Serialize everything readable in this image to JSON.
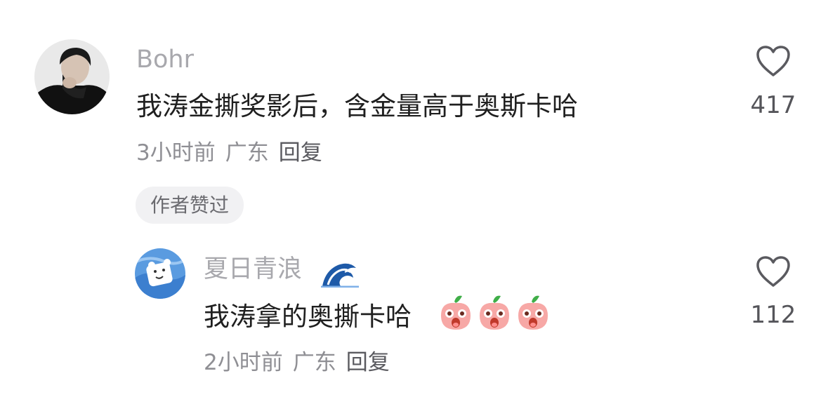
{
  "comments": [
    {
      "username": "Bohr",
      "text": "我涛金撕奖影后，含金量高于奥斯卡哈",
      "time": "3小时前",
      "location": "广东",
      "reply_label": "回复",
      "like_count": "417",
      "badge": "作者赞过"
    },
    {
      "username": "夏日青浪",
      "text": "我涛拿的奥撕卡哈",
      "time": "2小时前",
      "location": "广东",
      "reply_label": "回复",
      "like_count": "112",
      "emoji": "peach-emoji",
      "emoji_count": 3
    }
  ],
  "icons": {
    "like": "heart-outline-icon",
    "name_decoration": "wave-icon"
  },
  "colors": {
    "username": "#a8a8ad",
    "text": "#1f1f1f",
    "meta": "#8f8f94",
    "badge_bg": "#f1f1f3"
  }
}
